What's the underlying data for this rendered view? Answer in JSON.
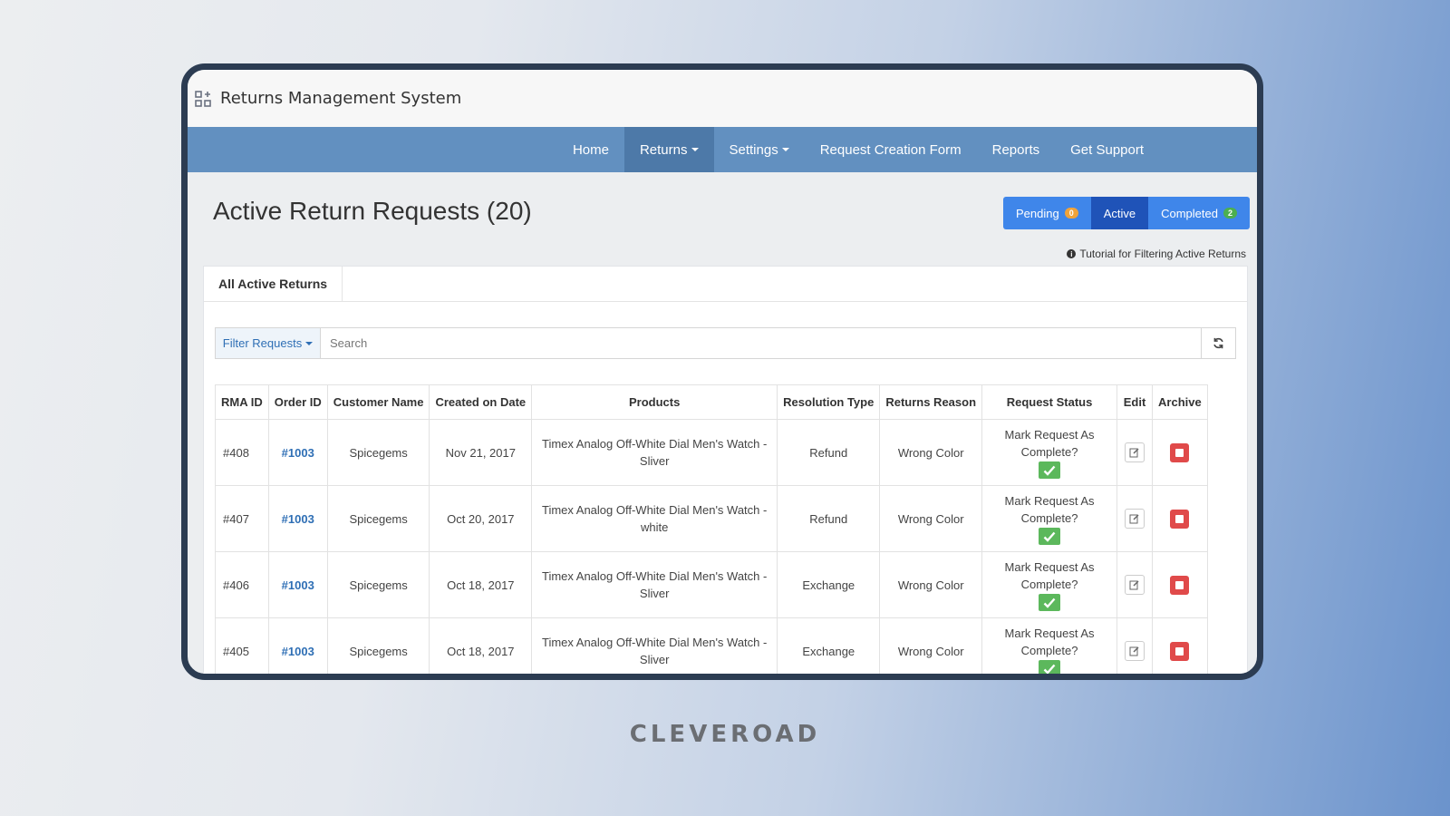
{
  "app": {
    "title": "Returns Management System"
  },
  "nav": [
    {
      "label": "Home",
      "active": false,
      "dropdown": false
    },
    {
      "label": "Returns",
      "active": true,
      "dropdown": true
    },
    {
      "label": "Settings",
      "active": false,
      "dropdown": true
    },
    {
      "label": "Request Creation Form",
      "active": false,
      "dropdown": false
    },
    {
      "label": "Reports",
      "active": false,
      "dropdown": false
    },
    {
      "label": "Get Support",
      "active": false,
      "dropdown": false
    }
  ],
  "page": {
    "title": "Active Return Requests (20)",
    "status_buttons": {
      "pending": {
        "label": "Pending",
        "count": "0"
      },
      "active": {
        "label": "Active"
      },
      "completed": {
        "label": "Completed",
        "count": "2"
      }
    },
    "tutorial_link": "Tutorial for Filtering Active Returns"
  },
  "tabs": {
    "all_active": "All Active Returns"
  },
  "search": {
    "filter_label": "Filter Requests",
    "placeholder": "Search"
  },
  "table": {
    "headers": {
      "rma_id": "RMA ID",
      "order_id": "Order ID",
      "customer_name": "Customer Name",
      "created_on": "Created on Date",
      "products": "Products",
      "resolution_type": "Resolution Type",
      "returns_reason": "Returns Reason",
      "request_status": "Request Status",
      "edit": "Edit",
      "archive": "Archive"
    },
    "mark_complete_label": "Mark Request As Complete?",
    "rows": [
      {
        "rma": "#408",
        "order": "#1003",
        "customer": "Spicegems",
        "date": "Nov 21, 2017",
        "product": "Timex Analog Off-White Dial Men's Watch - Sliver",
        "resolution": "Refund",
        "reason": "Wrong Color"
      },
      {
        "rma": "#407",
        "order": "#1003",
        "customer": "Spicegems",
        "date": "Oct 20, 2017",
        "product": "Timex Analog Off-White Dial Men's Watch - white",
        "resolution": "Refund",
        "reason": "Wrong Color"
      },
      {
        "rma": "#406",
        "order": "#1003",
        "customer": "Spicegems",
        "date": "Oct 18, 2017",
        "product": "Timex Analog Off-White Dial Men's Watch - Sliver",
        "resolution": "Exchange",
        "reason": "Wrong Color"
      },
      {
        "rma": "#405",
        "order": "#1003",
        "customer": "Spicegems",
        "date": "Oct 18, 2017",
        "product": "Timex Analog Off-White Dial Men's Watch - Sliver",
        "resolution": "Exchange",
        "reason": "Wrong Color"
      }
    ]
  },
  "brand": "CLEVEROAD",
  "colors": {
    "navbar": "#6290c0",
    "nav_active": "#4d79a8",
    "status_blue": "#3f86ea",
    "status_active": "#1f53b8",
    "link": "#2f6fb5",
    "complete_green": "#5cb85c",
    "archive_red": "#e04a4a",
    "device_frame": "#2c3c52"
  }
}
